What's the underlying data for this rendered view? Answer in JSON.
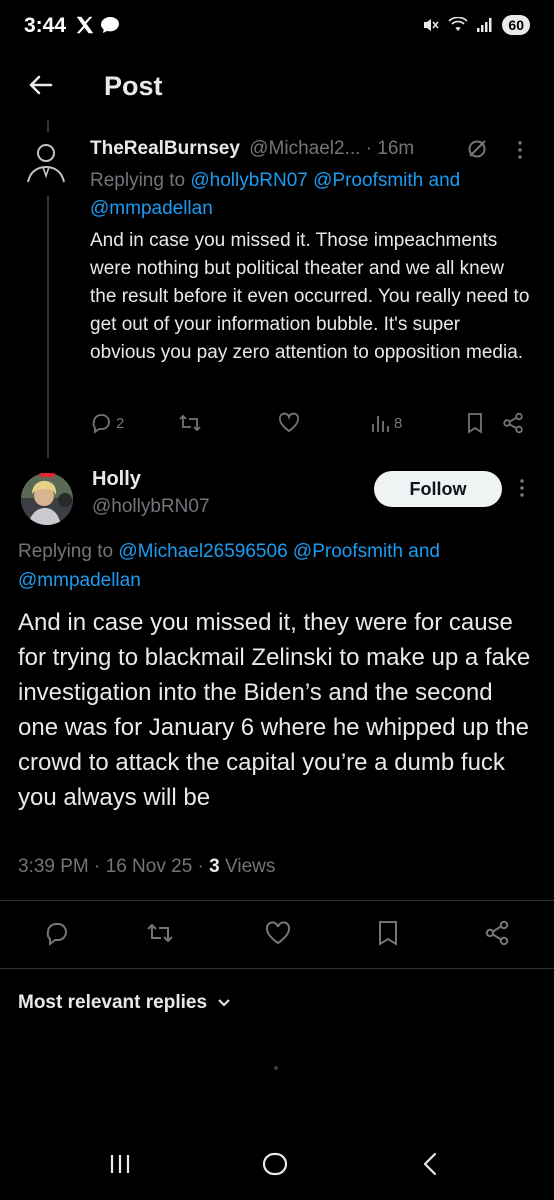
{
  "status": {
    "time": "3:44",
    "battery": "60"
  },
  "header": {
    "title": "Post"
  },
  "reply_tweet": {
    "display_name": "TheRealBurnsey",
    "handle_time": "@Michael2... · 16m",
    "replying_prefix": "Replying to",
    "mentions_line1": "@hollybRN07 @Proofsmith and",
    "mentions_line2": "@mmpadellan",
    "text": "And in case you missed it.  Those impeachments were nothing but political theater and we all knew the result before it even occurred. You really need to get out of your information bubble. It's super obvious you pay zero attention to opposition media.",
    "reply_count": "2",
    "views": "8"
  },
  "main_tweet": {
    "display_name": "Holly",
    "handle": "@hollybRN07",
    "follow_label": "Follow",
    "replying_prefix": "Replying to",
    "mentions_line1": "@Michael26596506 @Proofsmith and",
    "mentions_line2": "@mmpadellan",
    "text": "And in case you missed it, they were for cause for trying to blackmail Zelinski to make up a fake investigation into the Biden’s and the second one was for January 6 where he whipped up the crowd to attack the capital you’re a dumb fuck you always will be",
    "meta_time_date": "3:39 PM · 16 Nov 25 ·",
    "views_count": "3",
    "views_label": "Views"
  },
  "replies_sort": {
    "label": "Most relevant replies"
  },
  "colors": {
    "accent": "#1d9bf0",
    "background": "#000000",
    "muted": "#71767b"
  }
}
